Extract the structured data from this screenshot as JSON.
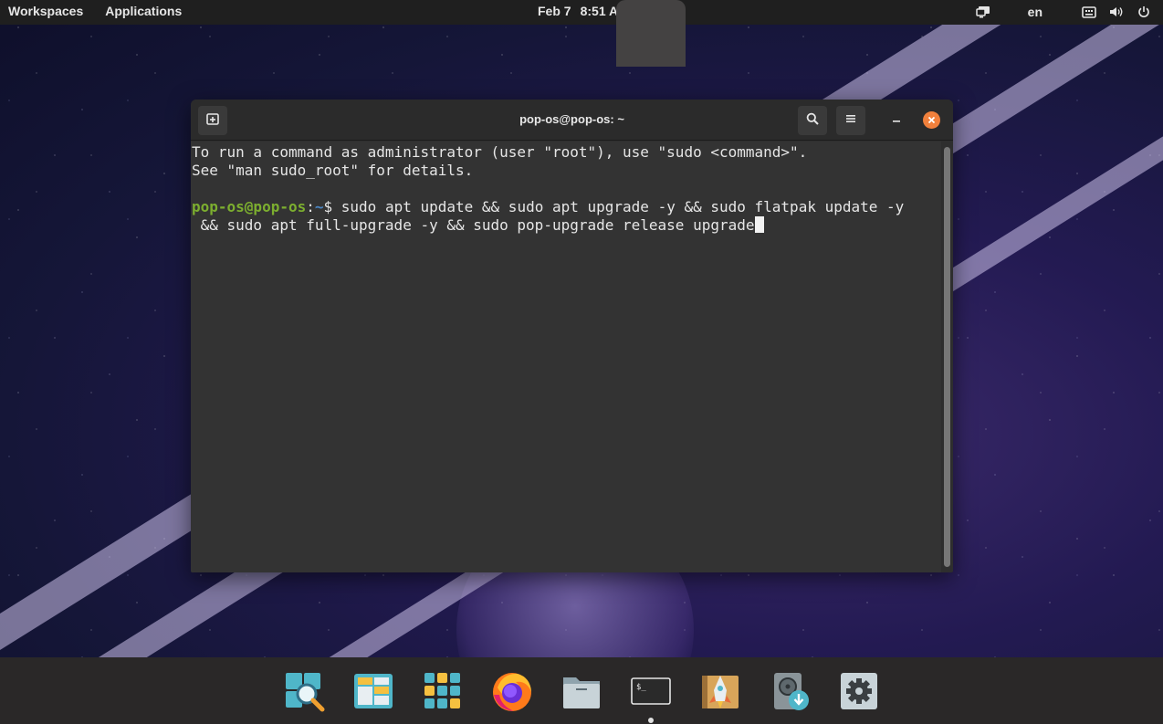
{
  "topbar": {
    "workspaces": "Workspaces",
    "applications": "Applications",
    "date": "Feb 7",
    "time": "8:51 AM",
    "language": "en",
    "icons": [
      "display-icon",
      "keyboard-icon",
      "volume-icon",
      "power-icon"
    ]
  },
  "window": {
    "title": "pop-os@pop-os: ~",
    "buttons": [
      "new-tab-icon",
      "search-icon",
      "menu-icon",
      "minimize-icon",
      "close-icon"
    ]
  },
  "terminal": {
    "line1": "To run a command as administrator (user \"root\"), use \"sudo <command>\".",
    "line2": "See \"man sudo_root\" for details.",
    "prompt_user": "pop-os@pop-os",
    "prompt_sep": ":",
    "prompt_path": "~",
    "prompt_dollar": "$ ",
    "command1": "sudo apt update && sudo apt upgrade -y && sudo flatpak update -y",
    "command2": " && sudo apt full-upgrade -y && sudo pop-upgrade release upgrade"
  },
  "dock": {
    "items": [
      {
        "name": "search-app-icon"
      },
      {
        "name": "workspaces-app-icon"
      },
      {
        "name": "app-library-icon"
      },
      {
        "name": "firefox-icon"
      },
      {
        "name": "files-icon"
      },
      {
        "name": "terminal-icon",
        "active": true
      },
      {
        "name": "pop-shop-icon"
      },
      {
        "name": "disk-utility-icon"
      },
      {
        "name": "settings-icon"
      }
    ]
  },
  "colors": {
    "accent": "#f0803c",
    "prompt_user": "#7cae2f",
    "prompt_path": "#4b86c4",
    "terminal_bg": "#333333"
  }
}
